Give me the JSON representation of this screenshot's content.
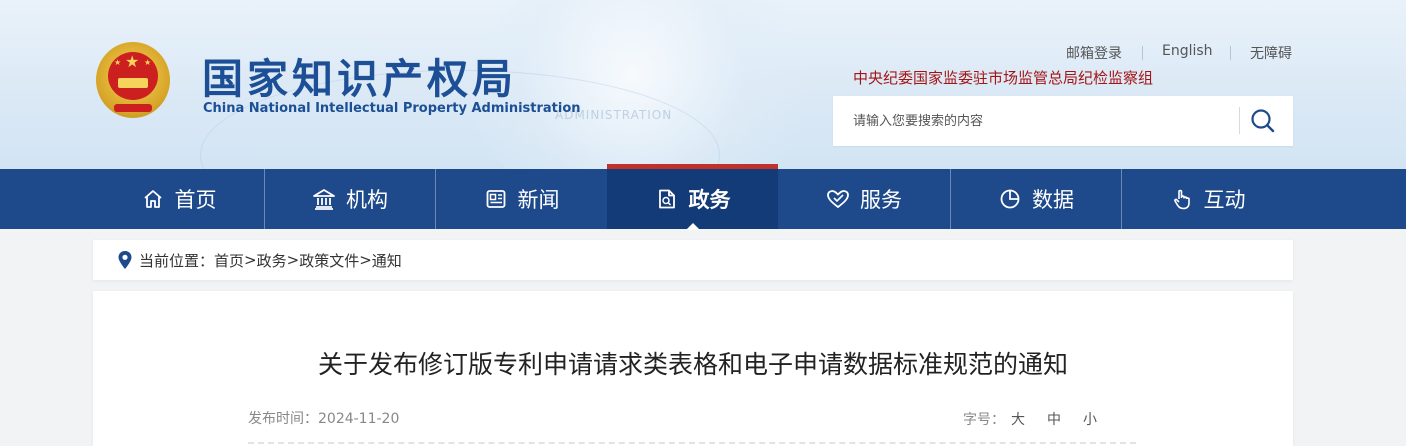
{
  "header": {
    "logo_cn": "国家知识产权局",
    "logo_en": "China National Intellectual Property Administration",
    "watermark": "ADMINISTRATION",
    "top_links": [
      "邮箱登录",
      "English",
      "无障碍"
    ],
    "supervision_link": "中央纪委国家监委驻市场监管总局纪检监察组",
    "search": {
      "placeholder": "请输入您要搜索的内容"
    }
  },
  "nav": {
    "items": [
      {
        "label": "首页",
        "icon": "home-icon"
      },
      {
        "label": "机构",
        "icon": "institution-icon"
      },
      {
        "label": "新闻",
        "icon": "news-icon"
      },
      {
        "label": "政务",
        "icon": "document-icon"
      },
      {
        "label": "服务",
        "icon": "heart-hand-icon"
      },
      {
        "label": "数据",
        "icon": "pie-chart-icon"
      },
      {
        "label": "互动",
        "icon": "pointer-hand-icon"
      }
    ],
    "active": "政务"
  },
  "breadcrumb": {
    "prefix": "当前位置：",
    "items": [
      "首页",
      "政务",
      "政策文件",
      "通知"
    ],
    "separator": ">"
  },
  "article": {
    "title": "关于发布修订版专利申请请求类表格和电子申请数据标准规范的通知",
    "publish_label": "发布时间：",
    "publish_date": "2024-11-20",
    "font_size_label": "字号：",
    "font_size_options": [
      "大",
      "中",
      "小"
    ]
  },
  "colors": {
    "nav_bg": "#1e4a8b",
    "nav_active_bg": "#133b78",
    "nav_active_top": "#c0312b",
    "logo_blue": "#1c4f95",
    "supervision_red": "#a31515"
  }
}
